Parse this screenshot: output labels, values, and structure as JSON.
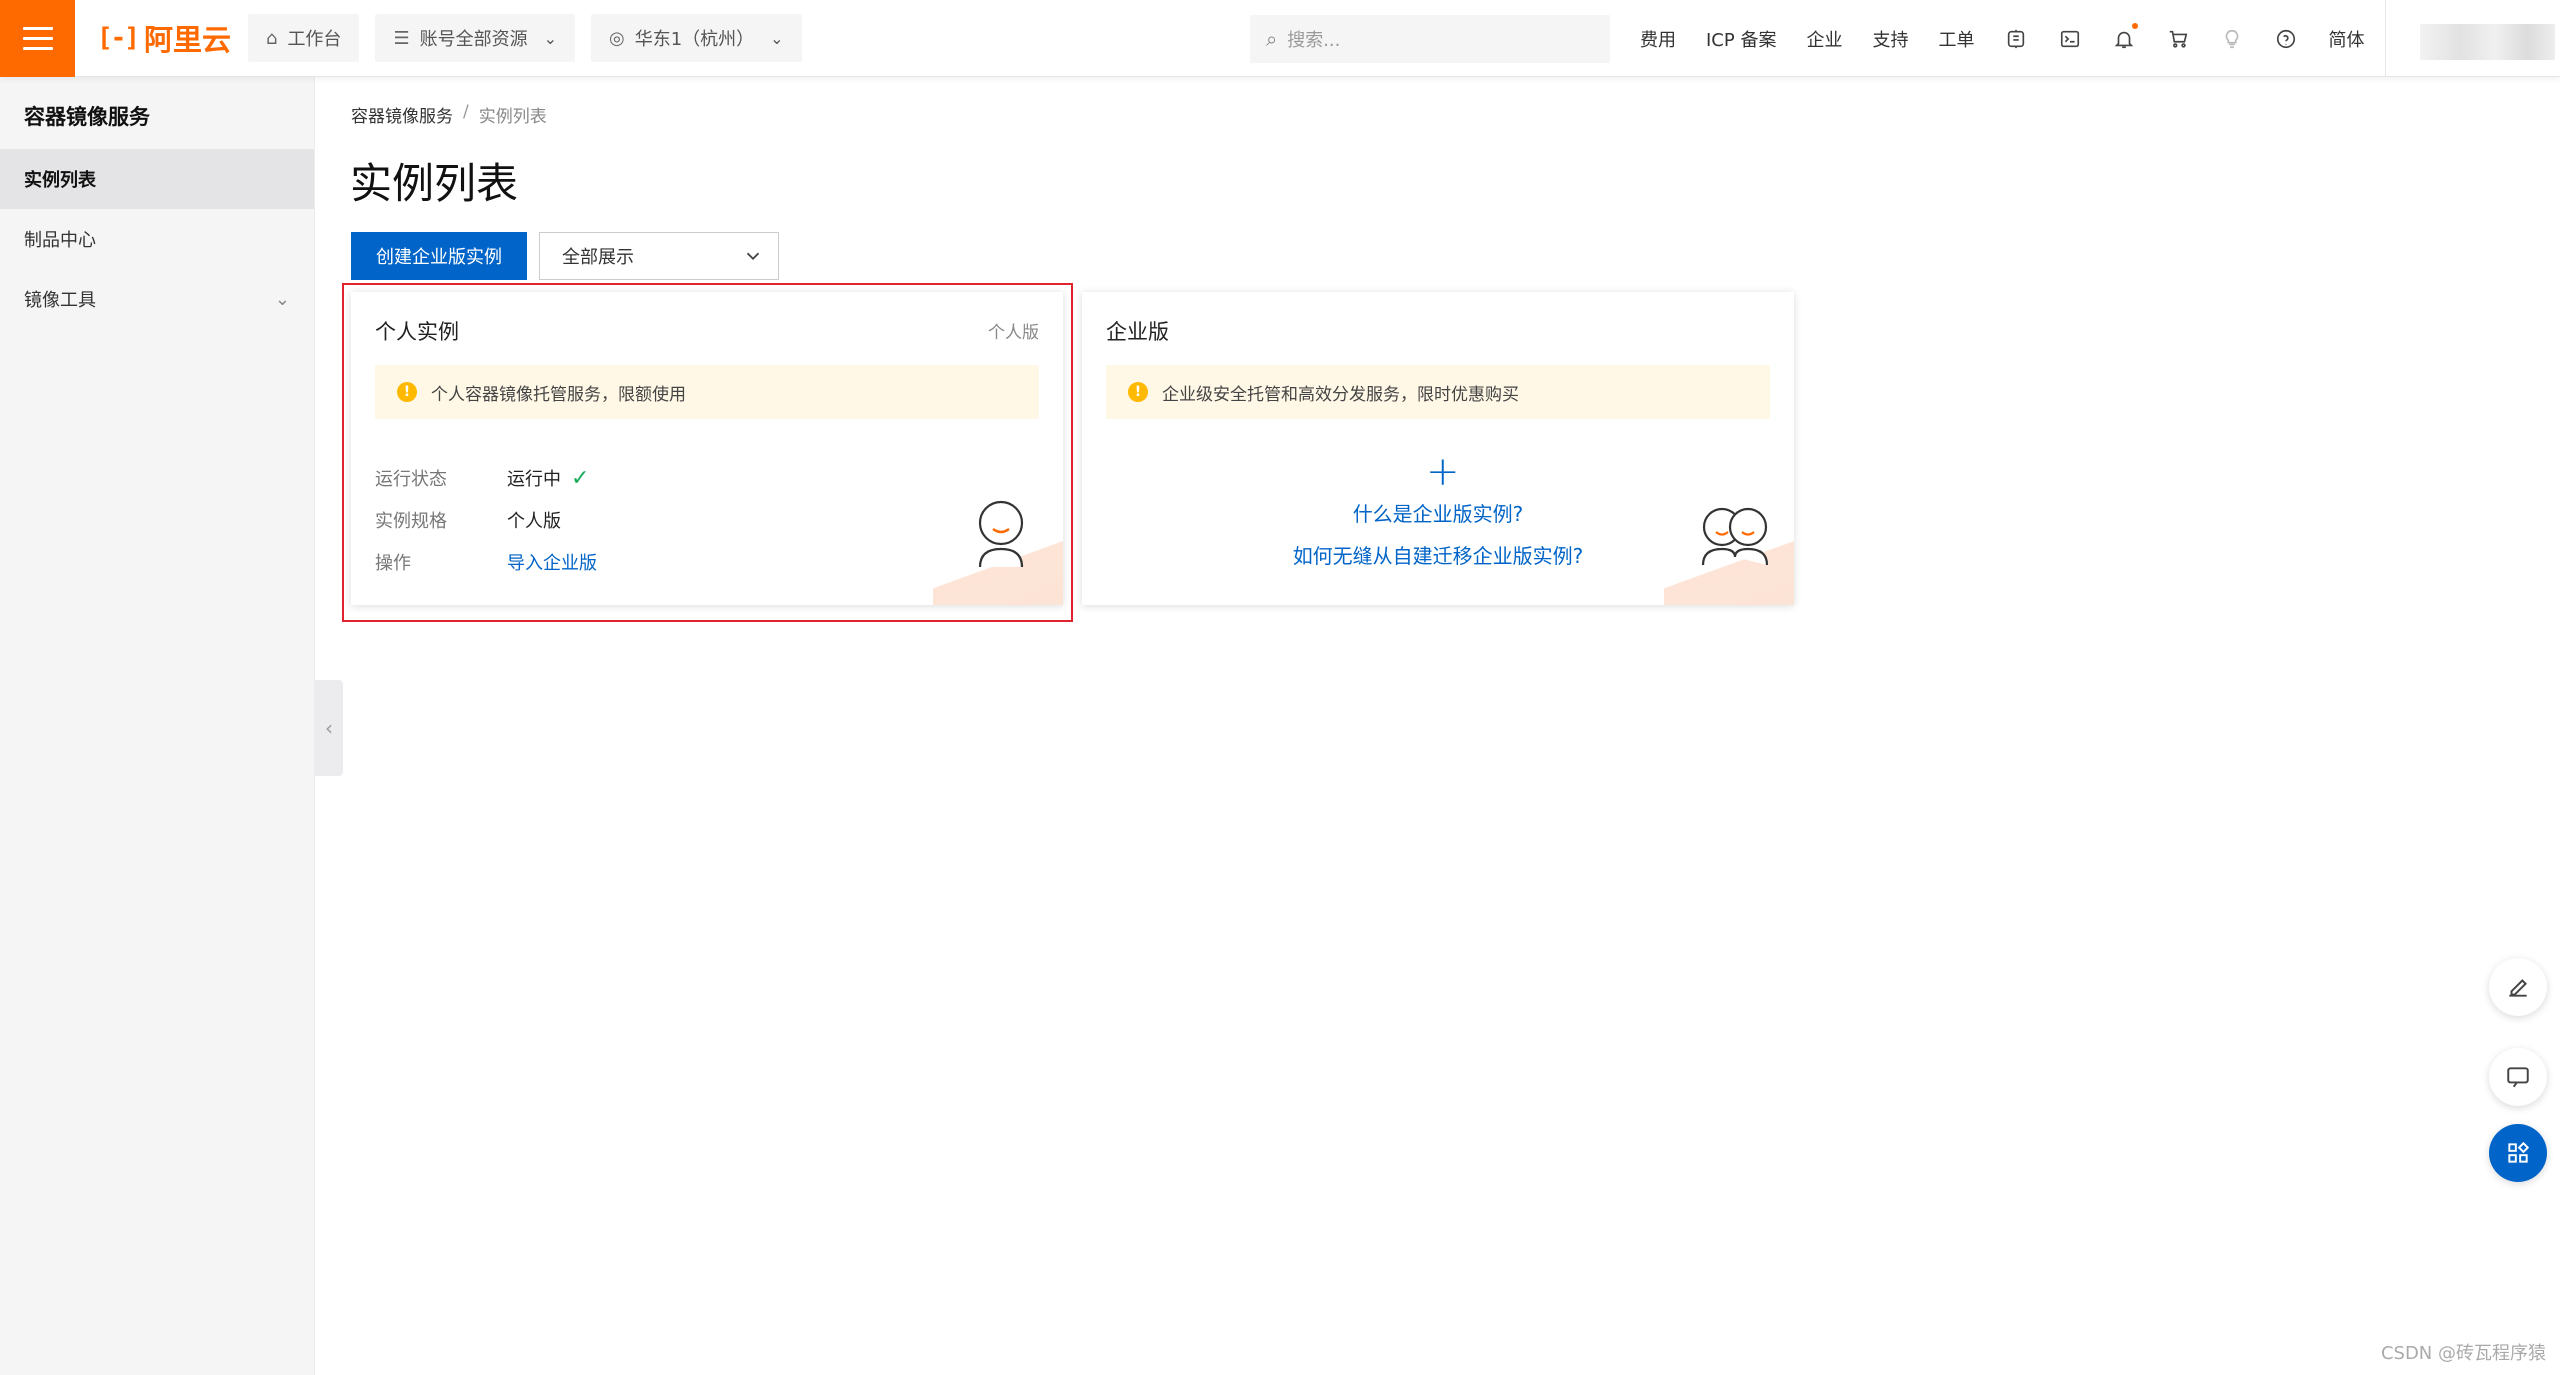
{
  "topbar": {
    "logo_text": "阿里云",
    "workbench": "工作台",
    "resource_scope": "账号全部资源",
    "region": "华东1（杭州）",
    "search_placeholder": "搜索...",
    "links": [
      "费用",
      "ICP 备案",
      "企业",
      "支持",
      "工单"
    ],
    "language": "简体"
  },
  "sidebar": {
    "title": "容器镜像服务",
    "items": [
      {
        "label": "实例列表",
        "active": true
      },
      {
        "label": "制品中心",
        "active": false
      },
      {
        "label": "镜像工具",
        "active": false,
        "expandable": true
      }
    ]
  },
  "breadcrumb": {
    "root": "容器镜像服务",
    "separator": "/",
    "current": "实例列表"
  },
  "main": {
    "title": "实例列表",
    "create_button": "创建企业版实例",
    "filter_select": "全部展示"
  },
  "personal_card": {
    "title": "个人实例",
    "tag": "个人版",
    "notice": "个人容器镜像托管服务，限额使用",
    "rows": [
      {
        "key": "运行状态",
        "value": "运行中"
      },
      {
        "key": "实例规格",
        "value": "个人版"
      },
      {
        "key": "操作",
        "value": "导入企业版"
      }
    ]
  },
  "enterprise_card": {
    "title": "企业版",
    "notice": "企业级安全托管和高效分发服务，限时优惠购买",
    "link_what": "什么是企业版实例?",
    "link_migrate": "如何无缝从自建迁移企业版实例?"
  },
  "watermark": "CSDN @砖瓦程序猿",
  "colors": {
    "brand_orange": "#ff6a00",
    "primary_blue": "#0064c8",
    "highlight_red": "#e0232f",
    "success_green": "#1aab5c",
    "warning_yellow": "#ffb900"
  }
}
